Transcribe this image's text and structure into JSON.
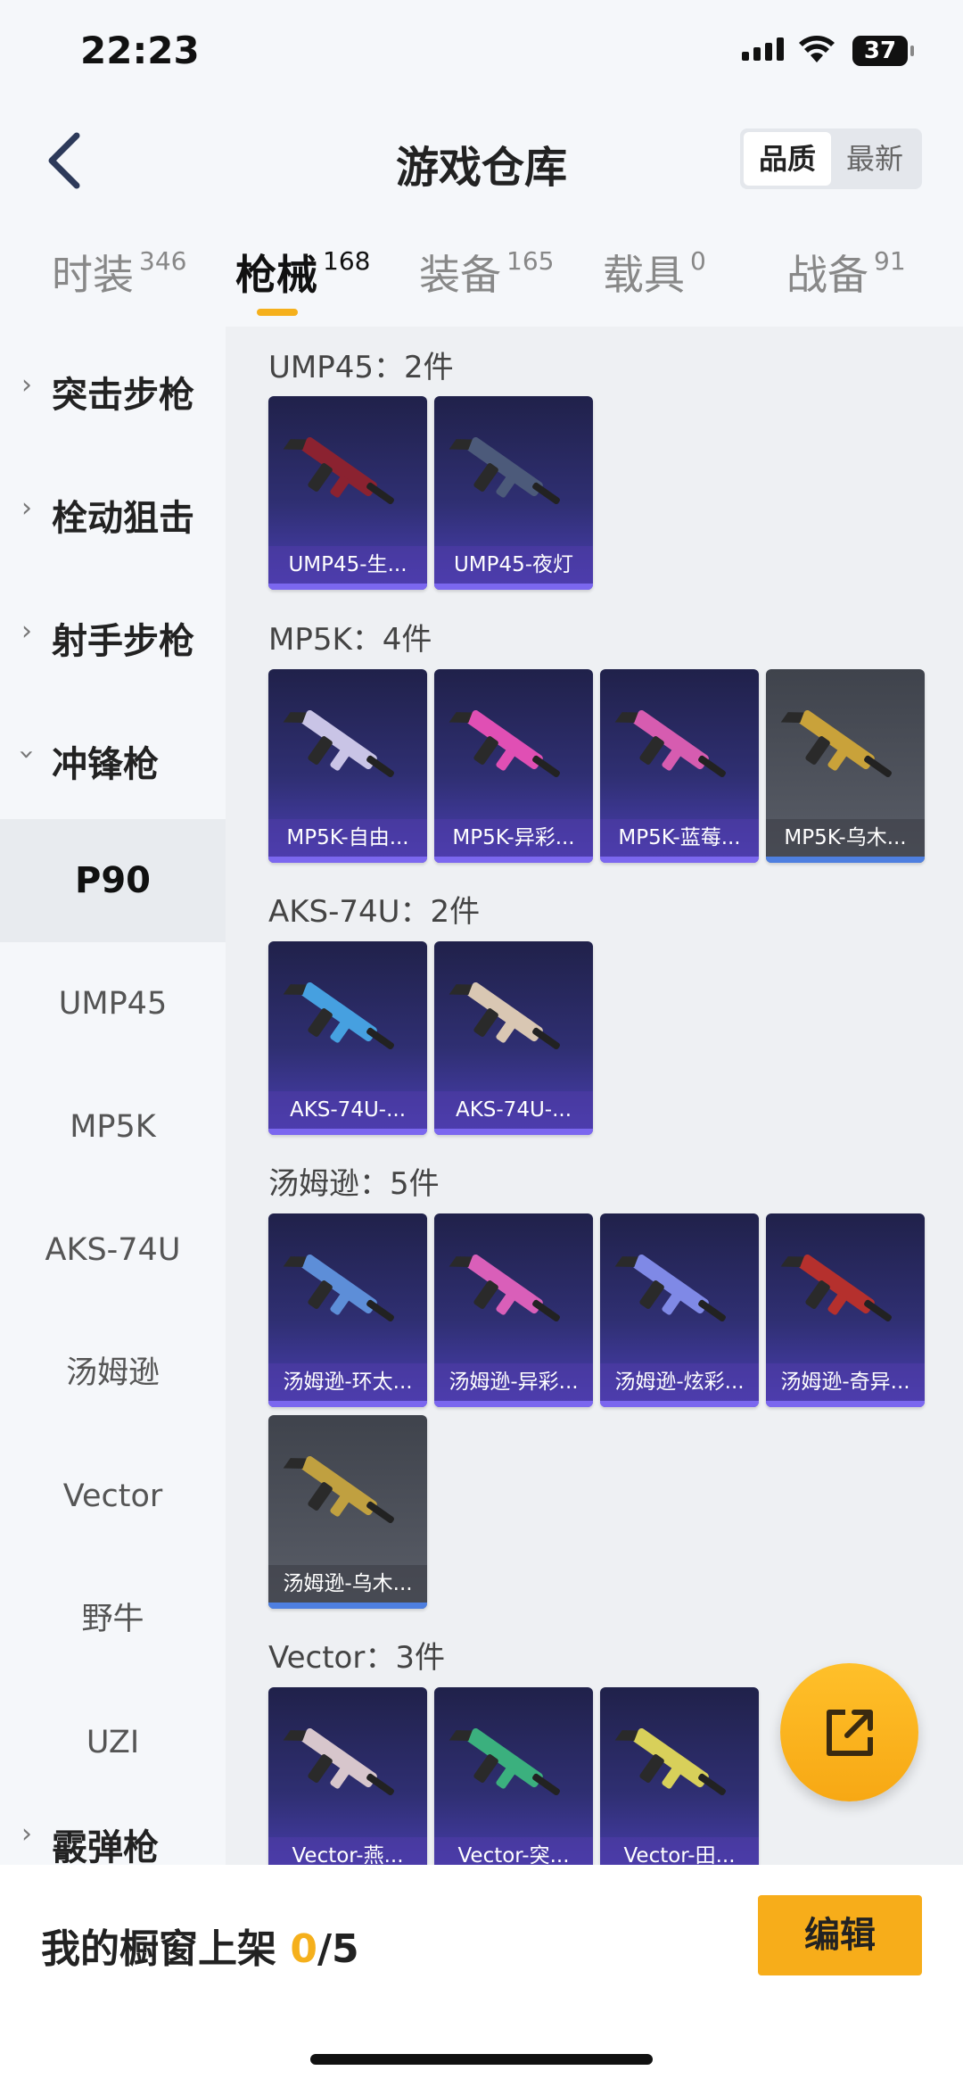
{
  "status": {
    "time": "22:23",
    "battery": "37"
  },
  "header": {
    "title": "游戏仓库",
    "sort_options": [
      "品质",
      "最新"
    ]
  },
  "tabs": [
    {
      "label": "时装",
      "count": "346"
    },
    {
      "label": "枪械",
      "count": "168"
    },
    {
      "label": "装备",
      "count": "165"
    },
    {
      "label": "载具",
      "count": "0"
    },
    {
      "label": "战备",
      "count": "91"
    }
  ],
  "sidebar": {
    "categories": [
      "突击步枪",
      "栓动狙击",
      "射手步枪",
      "冲锋枪"
    ],
    "subitems": [
      "P90",
      "UMP45",
      "MP5K",
      "AKS-74U",
      "汤姆逊",
      "Vector",
      "野牛",
      "UZI"
    ],
    "partial_next": "霰弹枪"
  },
  "groups": [
    {
      "title": "UMP45：2件",
      "items": [
        "UMP45-生...",
        "UMP45-夜灯"
      ]
    },
    {
      "title": "MP5K：4件",
      "items": [
        "MP5K-自由...",
        "MP5K-异彩...",
        "MP5K-蓝莓...",
        "MP5K-乌木..."
      ]
    },
    {
      "title": "AKS-74U：2件",
      "items": [
        "AKS-74U-...",
        "AKS-74U-..."
      ]
    },
    {
      "title": "汤姆逊：5件",
      "items": [
        "汤姆逊-环太...",
        "汤姆逊-异彩...",
        "汤姆逊-炫彩...",
        "汤姆逊-奇异...",
        "汤姆逊-乌木..."
      ]
    },
    {
      "title": "Vector：3件",
      "items": [
        "Vector-燕...",
        "Vector-突...",
        "Vector-田..."
      ]
    }
  ],
  "showcase": {
    "label": "我的橱窗上架",
    "current": "0",
    "total": "/5",
    "edit_label": "编辑"
  },
  "colors": {
    "accent": "#f5b01c",
    "card_purple": "#4b3fb5",
    "card_gray": "#5a5e68"
  }
}
